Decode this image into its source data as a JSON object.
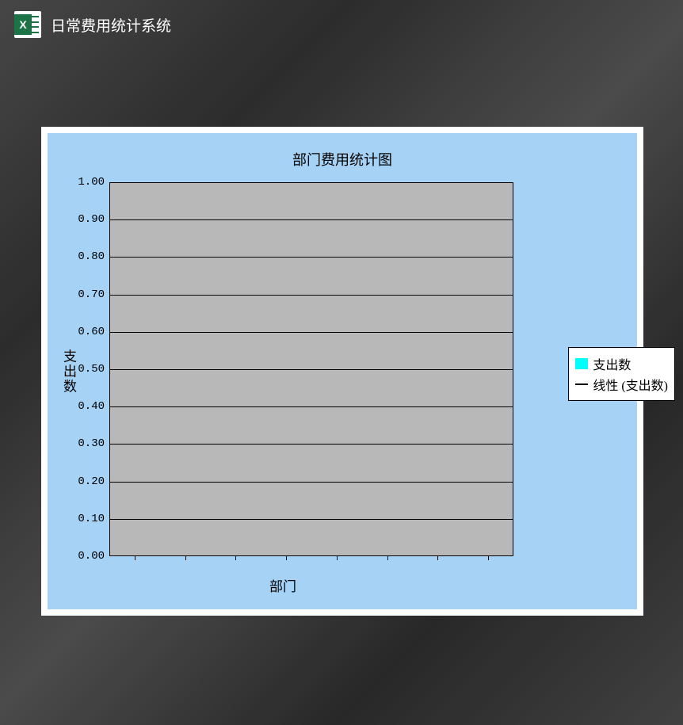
{
  "header": {
    "app_icon_letter": "X",
    "title": "日常费用统计系统"
  },
  "chart_data": {
    "type": "bar",
    "title": "部门费用统计图",
    "xlabel": "部门",
    "ylabel": "支出数",
    "ylim": [
      0.0,
      1.0
    ],
    "y_ticks": [
      "0.00",
      "0.10",
      "0.20",
      "0.30",
      "0.40",
      "0.50",
      "0.60",
      "0.70",
      "0.80",
      "0.90",
      "1.00"
    ],
    "categories": [],
    "series": [
      {
        "name": "支出数",
        "values": []
      },
      {
        "name": "线性 (支出数)",
        "values": []
      }
    ],
    "legend": {
      "items": [
        {
          "label": "支出数",
          "swatch": "cyan"
        },
        {
          "label": "线性 (支出数)",
          "swatch": "line"
        }
      ]
    }
  }
}
